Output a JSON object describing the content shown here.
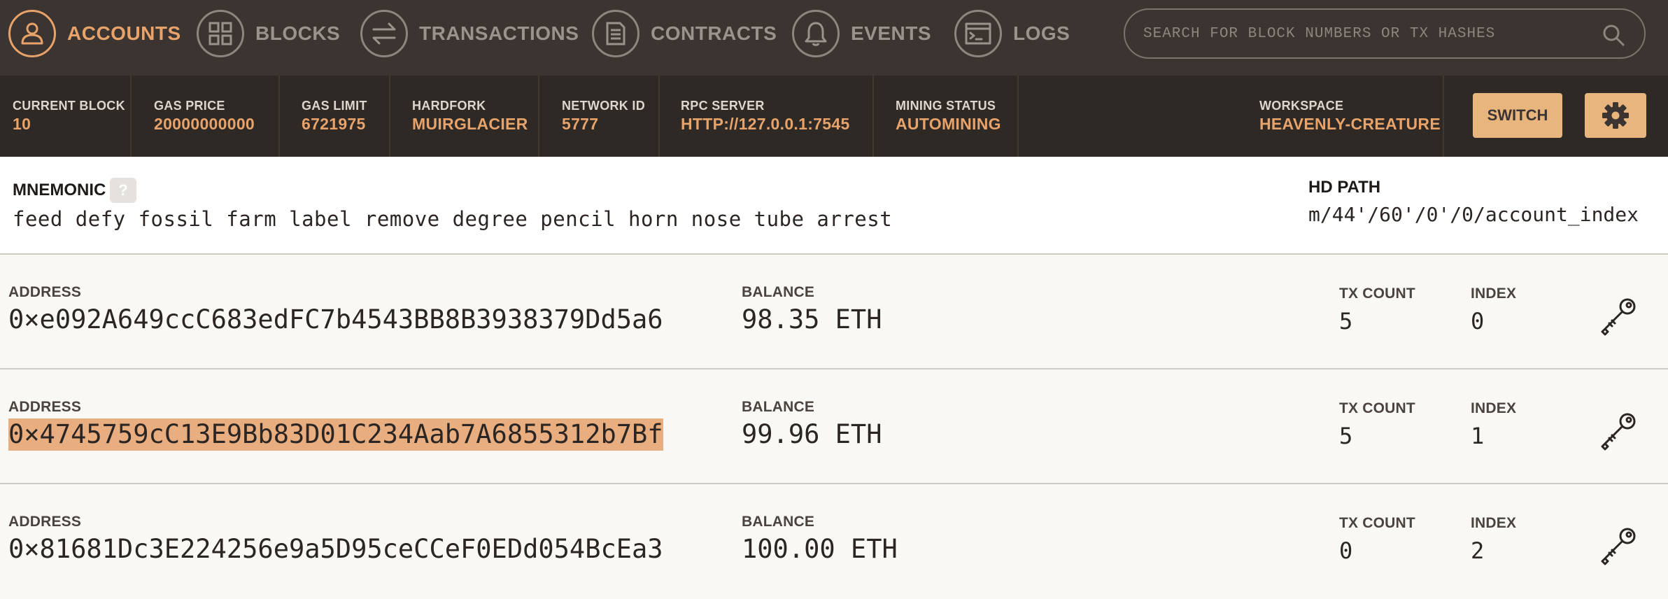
{
  "nav": {
    "items": [
      {
        "label": "ACCOUNTS",
        "icon": "user-icon",
        "active": true
      },
      {
        "label": "BLOCKS",
        "icon": "grid-icon"
      },
      {
        "label": "TRANSACTIONS",
        "icon": "swap-arrows-icon"
      },
      {
        "label": "CONTRACTS",
        "icon": "document-icon"
      },
      {
        "label": "EVENTS",
        "icon": "bell-icon"
      },
      {
        "label": "LOGS",
        "icon": "terminal-icon"
      }
    ],
    "search_placeholder": "SEARCH FOR BLOCK NUMBERS OR TX HASHES"
  },
  "status": {
    "current_block": {
      "label": "CURRENT BLOCK",
      "value": "10"
    },
    "gas_price": {
      "label": "GAS PRICE",
      "value": "20000000000"
    },
    "gas_limit": {
      "label": "GAS LIMIT",
      "value": "6721975"
    },
    "hardfork": {
      "label": "HARDFORK",
      "value": "MUIRGLACIER"
    },
    "network_id": {
      "label": "NETWORK ID",
      "value": "5777"
    },
    "rpc_server": {
      "label": "RPC SERVER",
      "value": "HTTP://127.0.0.1:7545"
    },
    "mining_status": {
      "label": "MINING STATUS",
      "value": "AUTOMINING"
    },
    "workspace": {
      "label": "WORKSPACE",
      "value": "HEAVENLY-CREATURE"
    },
    "switch_label": "SWITCH"
  },
  "mnemonic": {
    "title": "MNEMONIC",
    "help": "?",
    "words": "feed defy fossil farm label remove degree pencil horn nose tube arrest",
    "hd_path_title": "HD PATH",
    "hd_path_value": "m/44'/60'/0'/0/account_index"
  },
  "accounts": [
    {
      "address_label": "ADDRESS",
      "address": "0×e092A649ccC683edFC7b4543BB8B3938379Dd5a6",
      "balance_label": "BALANCE",
      "balance": "98.35 ETH",
      "tx_count_label": "TX COUNT",
      "tx_count": "5",
      "index_label": "INDEX",
      "index": "0"
    },
    {
      "address_label": "ADDRESS",
      "address": "0×4745759cC13E9Bb83D01C234Aab7A6855312b7Bf",
      "balance_label": "BALANCE",
      "balance": "99.96 ETH",
      "tx_count_label": "TX COUNT",
      "tx_count": "5",
      "index_label": "INDEX",
      "index": "1",
      "selected": true
    },
    {
      "address_label": "ADDRESS",
      "address": "0×81681Dc3E224256e9a5D95ceCCeF0EDd054BcEa3",
      "balance_label": "BALANCE",
      "balance": "100.00 ETH",
      "tx_count_label": "TX COUNT",
      "tx_count": "0",
      "index_label": "INDEX",
      "index": "2"
    }
  ],
  "colors": {
    "accent": "#e8a36b",
    "nav_bg": "#3b3430",
    "status_bg": "#2e2925",
    "selection": "#e9ae80"
  }
}
